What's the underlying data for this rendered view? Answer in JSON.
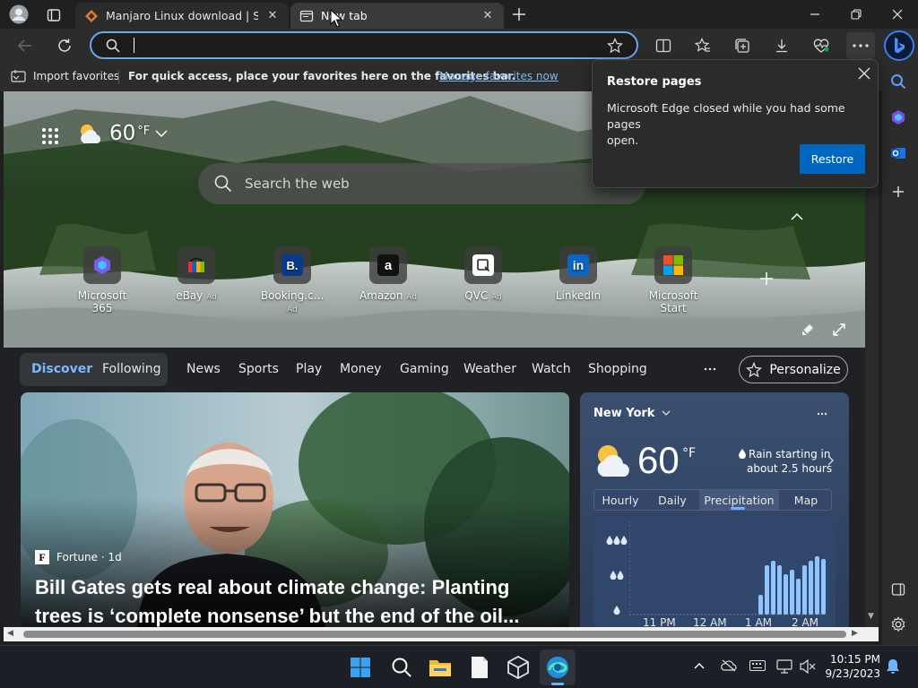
{
  "tabs": [
    {
      "title": "Manjaro Linux download | Source"
    },
    {
      "title": "New tab"
    }
  ],
  "favorites": {
    "import_label": "Import favorites",
    "hint": "For quick access, place your favorites here on the favorites bar.",
    "manage_link": "Manage favorites now"
  },
  "weather_top": {
    "temp": "60",
    "unit": "°F"
  },
  "search": {
    "placeholder": "Search the web"
  },
  "quick_links": [
    {
      "label": "Microsoft 365",
      "ad": ""
    },
    {
      "label": "eBay",
      "ad": "Ad"
    },
    {
      "label": "Booking.c...",
      "ad": "Ad"
    },
    {
      "label": "Amazon",
      "ad": "Ad"
    },
    {
      "label": "QVC",
      "ad": "Ad"
    },
    {
      "label": "LinkedIn",
      "ad": ""
    },
    {
      "label": "Microsoft Start",
      "ad": ""
    }
  ],
  "feed_nav": {
    "items": [
      "Discover",
      "Following",
      "News",
      "Sports",
      "Play",
      "Money",
      "Gaming",
      "Weather",
      "Watch",
      "Shopping"
    ],
    "personalize": "Personalize"
  },
  "article": {
    "source": "Fortune · 1d",
    "headline_line1": "Bill Gates gets real about climate change: Planting",
    "headline_line2": "trees is ‘complete nonsense’ but the end of the oil..."
  },
  "weather_card": {
    "location": "New York",
    "temp": "60",
    "unit": "°F",
    "rain_line1": "Rain starting in",
    "rain_line2": "about 2.5 hours",
    "tabs": [
      "Hourly",
      "Daily",
      "Precipitation",
      "Map"
    ],
    "x_labels": [
      "11 PM",
      "12 AM",
      "1 AM",
      "2 AM"
    ],
    "precip_bars": [
      0.22,
      0.55,
      0.6,
      0.55,
      0.45,
      0.5,
      0.4,
      0.55,
      0.6,
      0.65,
      0.62
    ]
  },
  "popup": {
    "title": "Restore pages",
    "body_line1": "Microsoft Edge closed while you had some pages",
    "body_line2": "open.",
    "button": "Restore"
  },
  "clock": {
    "time": "10:15 PM",
    "date": "9/23/2023"
  },
  "colors": {
    "accent": "#0067c0",
    "link": "#7ab7f5",
    "addr_border": "#6aa7e8"
  }
}
